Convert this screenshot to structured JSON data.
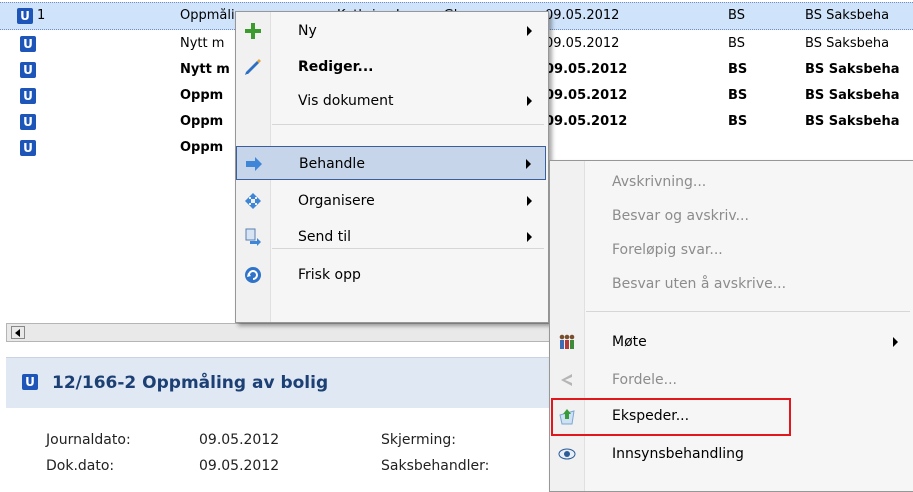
{
  "grid": {
    "rows": [
      {
        "icon": "U",
        "num": "1",
        "title": "Oppmåling a",
        "person": "Kathrine Larsen Gle",
        "date": "09.05.2012",
        "code": "BS",
        "role": "BS Saksbeha",
        "bold": false,
        "selected": true
      },
      {
        "icon": "U",
        "num": "",
        "title": "Nytt m",
        "person": "",
        "date": "09.05.2012",
        "code": "BS",
        "role": "BS Saksbeha",
        "bold": false,
        "selected": false
      },
      {
        "icon": "U",
        "num": "",
        "title": "Nytt m",
        "person": "",
        "date": "09.05.2012",
        "code": "BS",
        "role": "BS Saksbeha",
        "bold": true,
        "selected": false
      },
      {
        "icon": "U",
        "num": "",
        "title": "Oppm",
        "person": "",
        "date": "09.05.2012",
        "code": "BS",
        "role": "BS Saksbeha",
        "bold": true,
        "selected": false
      },
      {
        "icon": "U",
        "num": "",
        "title": "Oppm",
        "person": "",
        "date": "09.05.2012",
        "code": "BS",
        "role": "BS Saksbeha",
        "bold": true,
        "selected": false
      },
      {
        "icon": "U",
        "num": "",
        "title": "Oppm",
        "person": "",
        "date": "",
        "code": "",
        "role": "",
        "bold": true,
        "selected": false
      }
    ]
  },
  "context_menu": {
    "items": [
      {
        "label": "Ny",
        "icon": "plus-icon",
        "submenu": true,
        "bold": false
      },
      {
        "label": "Rediger...",
        "icon": "pencil-icon",
        "submenu": false,
        "bold": true
      },
      {
        "label": "Vis dokument",
        "icon": "",
        "submenu": true,
        "bold": false
      },
      {
        "label": "Behandle",
        "icon": "arrow-right-icon",
        "submenu": true,
        "bold": false,
        "highlighted": true
      },
      {
        "label": "Organisere",
        "icon": "move-icon",
        "submenu": true,
        "bold": false
      },
      {
        "label": "Send til",
        "icon": "send-icon",
        "submenu": true,
        "bold": false
      },
      {
        "label": "Frisk opp",
        "icon": "refresh-icon",
        "submenu": false,
        "bold": false
      }
    ]
  },
  "submenu": {
    "items": [
      {
        "label": "Avskrivning...",
        "enabled": false,
        "icon": "",
        "submenu": false
      },
      {
        "label": "Besvar og avskriv...",
        "enabled": false,
        "icon": "",
        "submenu": false
      },
      {
        "label": "Foreløpig svar...",
        "enabled": false,
        "icon": "",
        "submenu": false
      },
      {
        "label": "Besvar uten å avskrive...",
        "enabled": false,
        "icon": "",
        "submenu": false
      },
      {
        "label": "Møte",
        "enabled": true,
        "icon": "people-icon",
        "submenu": true
      },
      {
        "label": "Fordele...",
        "enabled": false,
        "icon": "share-icon",
        "submenu": false
      },
      {
        "label": "Ekspeder...",
        "enabled": true,
        "icon": "dispatch-icon",
        "submenu": false,
        "highlight_box": true
      },
      {
        "label": "Innsynsbehandling",
        "enabled": true,
        "icon": "eye-icon",
        "submenu": false
      }
    ]
  },
  "detail": {
    "icon": "U",
    "title": "12/166-2 Oppmåling av bolig",
    "journaldato_label": "Journaldato:",
    "journaldato_value": "09.05.2012",
    "dokdato_label": "Dok.dato:",
    "dokdato_value": "09.05.2012",
    "skjerming_label": "Skjerming:",
    "saksbehandler_label": "Saksbehandler:"
  },
  "colors": {
    "accent": "#1d55b8",
    "highlight": "#c6d5ea",
    "red_box": "#e2161d"
  }
}
